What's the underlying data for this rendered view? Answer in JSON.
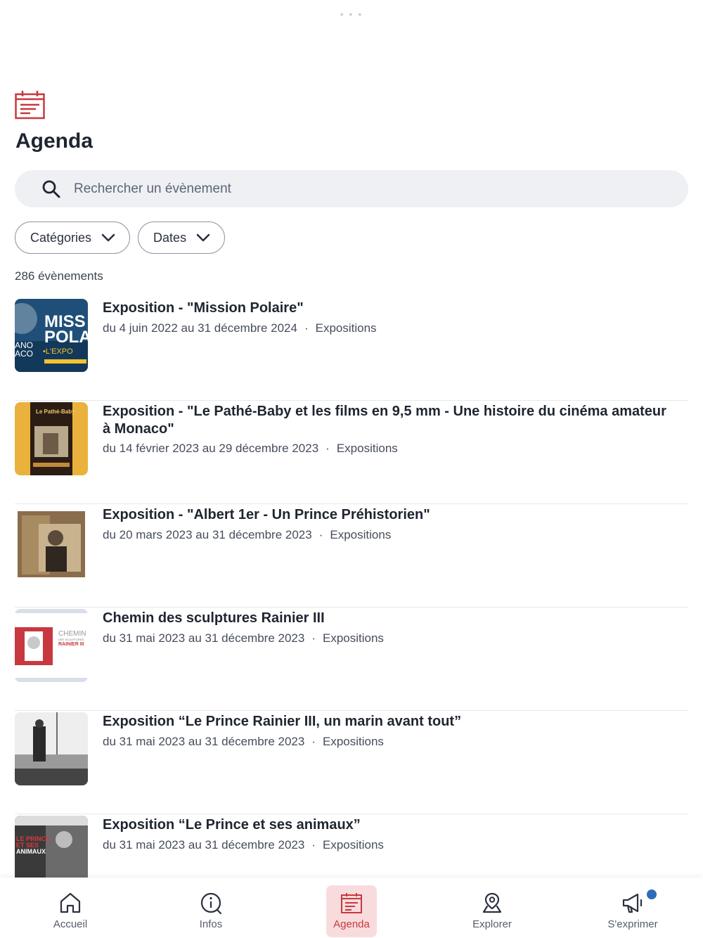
{
  "colors": {
    "accent": "#c8393f",
    "accent_bg": "#f8dcdd",
    "search_bg": "#eef0f4",
    "notification": "#2e6cb5"
  },
  "header": {
    "icon": "calendar-icon",
    "title": "Agenda"
  },
  "search": {
    "icon": "search-icon",
    "placeholder": "Rechercher un évènement"
  },
  "filters": [
    {
      "label": "Catégories",
      "icon": "chevron-down-icon"
    },
    {
      "label": "Dates",
      "icon": "chevron-down-icon"
    }
  ],
  "results_count": "286 évènements",
  "events": [
    {
      "title": "Exposition - \"Mission Polaire\"",
      "dates": "du 4 juin 2022 au 31 décembre 2024",
      "category": "Expositions"
    },
    {
      "title": "Exposition - \"Le Pathé-Baby et les films en 9,5 mm - Une histoire du cinéma amateur à Monaco\"",
      "dates": "du 14 février 2023 au 29 décembre 2023",
      "category": "Expositions"
    },
    {
      "title": "Exposition - \"Albert 1er - Un Prince Préhistorien\"",
      "dates": "du 20 mars 2023 au 31 décembre 2023",
      "category": "Expositions"
    },
    {
      "title": "Chemin des sculptures Rainier III",
      "dates": "du 31 mai 2023 au 31 décembre 2023",
      "category": "Expositions"
    },
    {
      "title": "Exposition “Le Prince Rainier III, un marin avant tout”",
      "dates": "du 31 mai 2023 au 31 décembre 2023",
      "category": "Expositions"
    },
    {
      "title": "Exposition “Le Prince et ses animaux”",
      "dates": "du 31 mai 2023 au 31 décembre 2023",
      "category": "Expositions"
    }
  ],
  "thumb_text": {
    "mission_1": "MISS",
    "mission_2": "POLA",
    "mission_3": "•L'EXPO",
    "mission_4": "ANO",
    "mission_5": "ACO",
    "pathe": "Le Pathé-Baby",
    "chemin_1": "CHEMIN",
    "chemin_2": "DES SCULPTURES",
    "chemin_3": "RAINIER III",
    "animaux_1": "LE PRINCE",
    "animaux_2": "ET SES",
    "animaux_3": "ANIMAUX"
  },
  "tabbar": {
    "active": "Agenda",
    "tabs": [
      {
        "label": "Accueil",
        "icon": "home-icon"
      },
      {
        "label": "Infos",
        "icon": "info-icon"
      },
      {
        "label": "Agenda",
        "icon": "calendar-icon"
      },
      {
        "label": "Explorer",
        "icon": "map-pin-icon"
      },
      {
        "label": "S'exprimer",
        "icon": "megaphone-icon"
      }
    ]
  }
}
